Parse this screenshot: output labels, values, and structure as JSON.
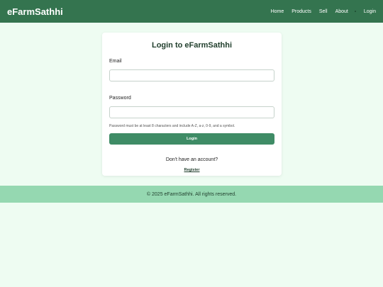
{
  "nav": {
    "brand": "eFarmSathhi",
    "links": [
      "Home",
      "Products",
      "Sell",
      "About",
      "Login"
    ]
  },
  "login": {
    "title": "Login to eFarmSathhi",
    "email_label": "Email",
    "email_value": "",
    "password_label": "Password",
    "password_value": "",
    "password_hint": "Password must be at least 8 characters and include A-Z, a-z, 0-9, and a symbol.",
    "login_button": "Login",
    "no_account_text": "Don't have an account?",
    "register_link": "Register"
  },
  "footer": {
    "text": "© 2025 eFarmSathhi. All rights reserved."
  },
  "colors": {
    "header_bg": "#34744f",
    "page_bg": "#eefcf2",
    "button_bg": "#3f8c66",
    "footer_bg": "#95d8b1"
  }
}
